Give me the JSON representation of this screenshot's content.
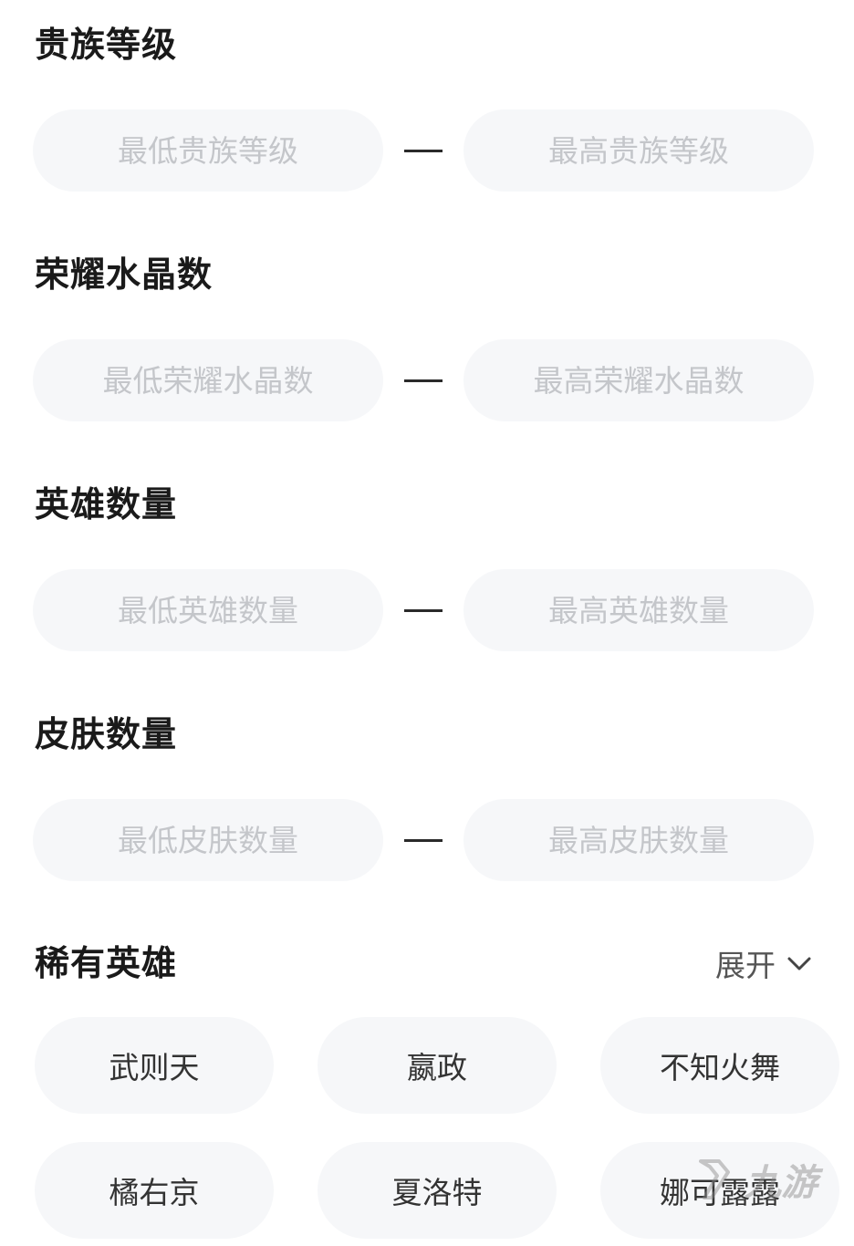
{
  "sections": [
    {
      "title": "贵族等级",
      "min_placeholder": "最低贵族等级",
      "max_placeholder": "最高贵族等级"
    },
    {
      "title": "荣耀水晶数",
      "min_placeholder": "最低荣耀水晶数",
      "max_placeholder": "最高荣耀水晶数"
    },
    {
      "title": "英雄数量",
      "min_placeholder": "最低英雄数量",
      "max_placeholder": "最高英雄数量"
    },
    {
      "title": "皮肤数量",
      "min_placeholder": "最低皮肤数量",
      "max_placeholder": "最高皮肤数量"
    }
  ],
  "rare_heroes": {
    "title": "稀有英雄",
    "expand_label": "展开",
    "expand_icon": "chevron-down-icon",
    "items": [
      "武则天",
      "嬴政",
      "不知火舞",
      "橘右京",
      "夏洛特",
      "娜可露露"
    ]
  },
  "watermark": {
    "text": "九游"
  }
}
